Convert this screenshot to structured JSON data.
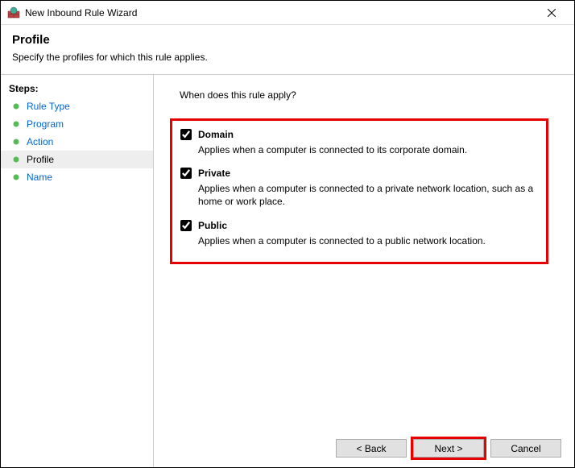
{
  "window": {
    "title": "New Inbound Rule Wizard"
  },
  "header": {
    "title": "Profile",
    "subtitle": "Specify the profiles for which this rule applies."
  },
  "sidebar": {
    "label": "Steps:",
    "items": [
      {
        "label": "Rule Type",
        "current": false
      },
      {
        "label": "Program",
        "current": false
      },
      {
        "label": "Action",
        "current": false
      },
      {
        "label": "Profile",
        "current": true
      },
      {
        "label": "Name",
        "current": false
      }
    ]
  },
  "content": {
    "prompt": "When does this rule apply?",
    "options": [
      {
        "label": "Domain",
        "desc": "Applies when a computer is connected to its corporate domain.",
        "checked": true
      },
      {
        "label": "Private",
        "desc": "Applies when a computer is connected to a private network location, such as a home or work place.",
        "checked": true
      },
      {
        "label": "Public",
        "desc": "Applies when a computer is connected to a public network location.",
        "checked": true
      }
    ]
  },
  "buttons": {
    "back": "< Back",
    "next": "Next >",
    "cancel": "Cancel"
  }
}
